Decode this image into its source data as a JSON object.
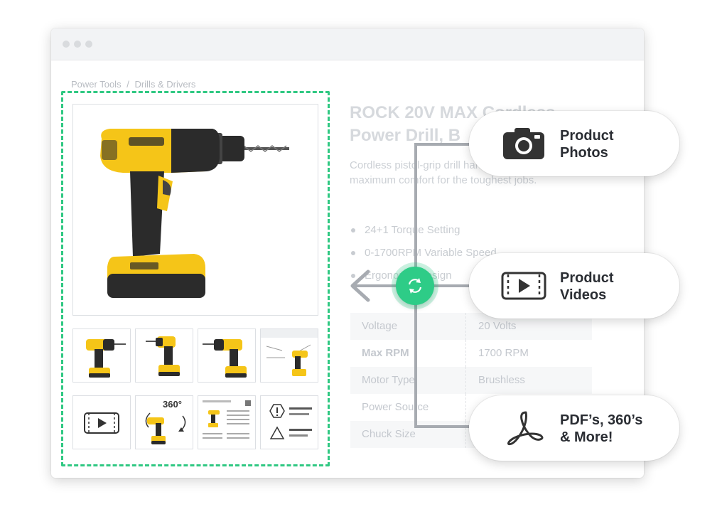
{
  "breadcrumb": {
    "items": [
      "Power Tools",
      "/",
      "Drills & Drivers"
    ]
  },
  "product": {
    "title_line1": "ROCK 20V MAX Cordless",
    "title_line2": "Power Drill, B",
    "description": "Cordless pistol-grip drill handle design which offers maximum comfort for the toughest jobs.",
    "features": [
      "24+1 Torque Setting",
      "0-1700RPM Variable Speed",
      "Ergonomic Design"
    ]
  },
  "specs": [
    {
      "key": "Voltage",
      "value": "20 Volts"
    },
    {
      "key": "Max RPM",
      "value": "1700 RPM"
    },
    {
      "key": "Motor Type",
      "value": "Brushless"
    },
    {
      "key": "Power Source",
      "value": ""
    },
    {
      "key": "Chuck Size",
      "value": ""
    }
  ],
  "thumbnails": {
    "row1": [
      "drill-angle-left",
      "drill-front",
      "drill-side",
      "drill-diagram"
    ],
    "row2": [
      "video-icon",
      "360-view",
      "spec-sheet",
      "warning-sheet"
    ],
    "badge_360": "360°"
  },
  "callouts": [
    {
      "icon": "camera-icon",
      "line1": "Product",
      "line2": "Photos"
    },
    {
      "icon": "video-icon",
      "line1": "Product",
      "line2": "Videos"
    },
    {
      "icon": "pdf-icon",
      "line1": "PDF’s, 360’s",
      "line2": "& More!"
    }
  ],
  "colors": {
    "accent_green": "#2ecc87",
    "drill_yellow": "#f5c518",
    "drill_black": "#2b2b2b",
    "muted_text": "#c8ccd1"
  }
}
